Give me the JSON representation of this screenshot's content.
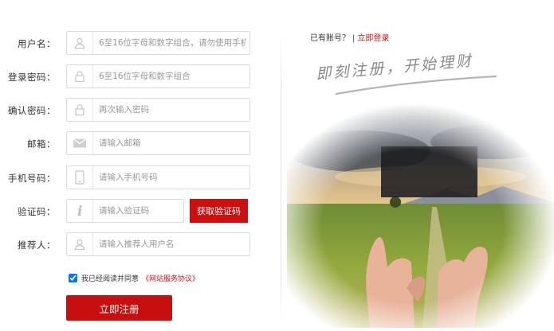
{
  "form": {
    "rows": [
      {
        "label": "用户名：",
        "placeholder": "6至16位字母和数字组合，请勿使用手机号",
        "icon": "user-icon"
      },
      {
        "label": "登录密码：",
        "placeholder": "6至16位字母和数字组合",
        "icon": "lock-icon"
      },
      {
        "label": "确认密码：",
        "placeholder": "再次输入密码",
        "icon": "lock-icon"
      },
      {
        "label": "邮箱：",
        "placeholder": "请输入邮箱",
        "icon": "envelope-icon"
      },
      {
        "label": "手机号码：",
        "placeholder": "请输入手机号码",
        "icon": "mobile-phone-icon"
      },
      {
        "label": "验证码：",
        "placeholder": "请输入验证码",
        "icon": "info-icon"
      },
      {
        "label": "推荐人：",
        "placeholder": "请输入推荐人用户名",
        "icon": "user-icon"
      }
    ],
    "get_code_label": "获取验证码",
    "agree_text": "我已经阅读并同意",
    "agree_link": "《网站服务协议》",
    "agree_checked": true,
    "submit_label": "立即注册"
  },
  "aside": {
    "have_account": "已有账号？",
    "separator": "|",
    "login_link": "立即登录",
    "slogan": "即刻注册，开始理财"
  },
  "colors": {
    "accent": "#cc1010",
    "border": "#dcdcdc",
    "placeholder": "#999999"
  }
}
